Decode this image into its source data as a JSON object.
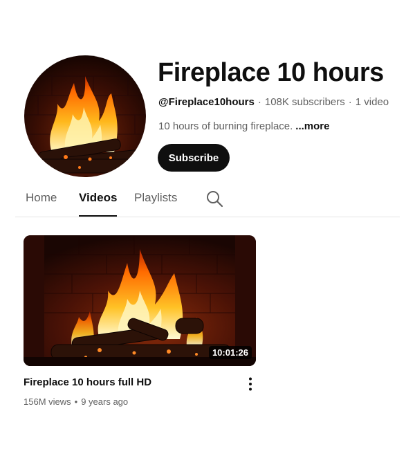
{
  "channel": {
    "title": "Fireplace 10 hours",
    "handle": "@Fireplace10hours",
    "subscribers": "108K subscribers",
    "video_count": "1 video",
    "description": "10 hours of burning fireplace.",
    "more_label": "...more",
    "subscribe_label": "Subscribe",
    "avatar_icon": "fireplace-image"
  },
  "tabs": [
    {
      "label": "Home",
      "active": false
    },
    {
      "label": "Videos",
      "active": true
    },
    {
      "label": "Playlists",
      "active": false
    }
  ],
  "search_icon": "search-icon",
  "videos": [
    {
      "title": "Fireplace 10 hours full HD",
      "duration": "10:01:26",
      "views": "156M views",
      "age": "9 years ago",
      "menu_icon": "more-vert-icon"
    }
  ],
  "colors": {
    "text_primary": "#0f0f0f",
    "text_secondary": "#606060",
    "subscribe_bg": "#0f0f0f",
    "divider": "#e5e5e5"
  }
}
